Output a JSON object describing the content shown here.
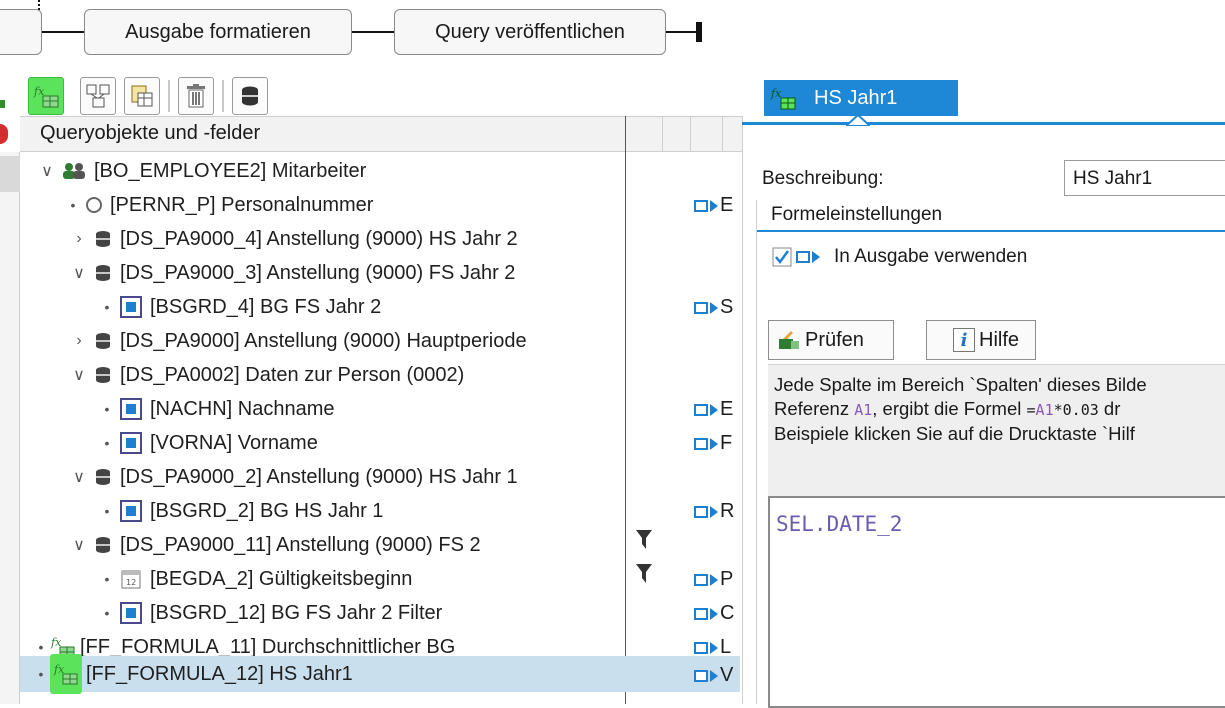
{
  "workflow": {
    "step_format": "Ausgabe formatieren",
    "step_publish": "Query veröffentlichen"
  },
  "toolbar": {
    "icons": [
      "formula-icon",
      "join-icon",
      "table-icon",
      "delete-icon",
      "database-icon"
    ]
  },
  "tree": {
    "header": "Queryobjekte und -felder",
    "rows": [
      {
        "label": "[BO_EMPLOYEE2] Mitarbeiter",
        "output": ""
      },
      {
        "label": "[PERNR_P] Personalnummer",
        "output": "E"
      },
      {
        "label": "[DS_PA9000_4] Anstellung (9000) HS Jahr 2",
        "output": ""
      },
      {
        "label": "[DS_PA9000_3] Anstellung (9000) FS Jahr 2",
        "output": ""
      },
      {
        "label": "[BSGRD_4] BG FS Jahr 2",
        "output": "S"
      },
      {
        "label": "[DS_PA9000] Anstellung (9000) Hauptperiode",
        "output": ""
      },
      {
        "label": "[DS_PA0002] Daten zur Person (0002)",
        "output": ""
      },
      {
        "label": "[NACHN] Nachname",
        "output": "E"
      },
      {
        "label": "[VORNA] Vorname",
        "output": "F"
      },
      {
        "label": "[DS_PA9000_2] Anstellung (9000) HS Jahr 1",
        "output": ""
      },
      {
        "label": "[BSGRD_2] BG HS Jahr 1",
        "output": "R"
      },
      {
        "label": "[DS_PA9000_11] Anstellung (9000) FS 2",
        "output": ""
      },
      {
        "label": "[BEGDA_2] Gültigkeitsbeginn",
        "output": "P"
      },
      {
        "label": "[BSGRD_12] BG FS Jahr 2 Filter",
        "output": "C"
      },
      {
        "label": "[FF_FORMULA_11] Durchschnittlicher BG",
        "output": "L"
      },
      {
        "label": "[FF_FORMULA_12] HS Jahr1",
        "output": "V"
      }
    ]
  },
  "panel": {
    "tab_title": "HS Jahr1",
    "desc_label": "Beschreibung:",
    "desc_value": "HS Jahr1",
    "section_title": "Formeleinstellungen",
    "use_in_output_label": "In Ausgabe verwenden",
    "check_button": "Prüfen",
    "help_button": "Hilfe",
    "help_line1": "Jede Spalte im Bereich `Spalten' dieses Bilde",
    "help_line2_pre": "Referenz ",
    "help_line2_ref": "A1",
    "help_line2_mid": ", ergibt die Formel ",
    "help_line2_formula_eq": "=",
    "help_line2_formula_a": "A1",
    "help_line2_formula_b": "*0.03",
    "help_line2_post": " dr",
    "help_line3": "Beispiele klicken Sie auf die Drucktaste `Hilf",
    "formula": "SEL.DATE_2"
  },
  "colors": {
    "accent": "#1e87d6",
    "selection": "#c9dfee",
    "highlight_green": "#5be35b"
  }
}
